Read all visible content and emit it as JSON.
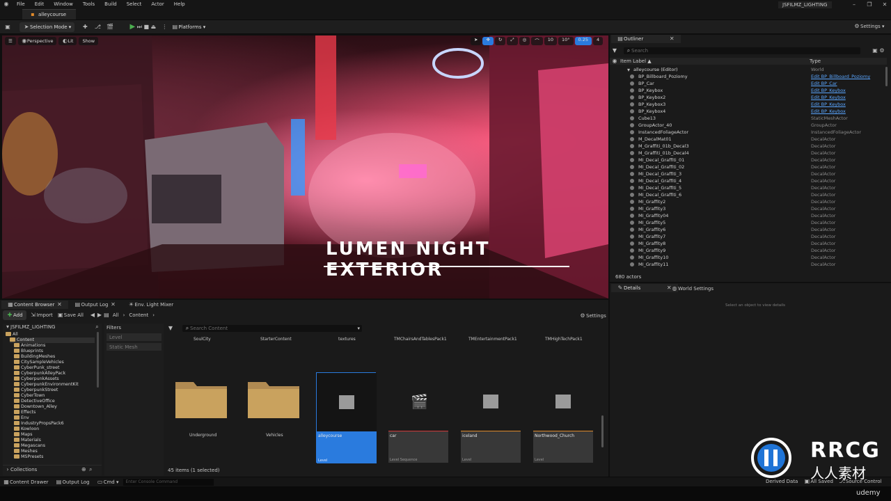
{
  "menu": [
    "File",
    "Edit",
    "Window",
    "Tools",
    "Build",
    "Select",
    "Actor",
    "Help"
  ],
  "project_name": "JSFILMZ_LIGHTING",
  "doc_tab": "alleycourse",
  "toolbar": {
    "mode": "Selection Mode",
    "platforms": "Platforms",
    "settings": "Settings"
  },
  "viewport": {
    "perspective": "Perspective",
    "lit": "Lit",
    "show": "Show",
    "banner": "LUMEN NIGHT EXTERIOR",
    "stats": [
      "10",
      "10°",
      "0.25",
      "4"
    ]
  },
  "outliner": {
    "tab": "Outliner",
    "search_placeholder": "Search",
    "col_label": "Item Label ▲",
    "col_type": "Type",
    "root": {
      "label": "alleycourse (Editor)",
      "type": "World"
    },
    "rows": [
      {
        "label": "BP_Billboard_Poziomy",
        "type": "Edit BP_Billboard_Poziomy",
        "link": true
      },
      {
        "label": "BP_Car",
        "type": "Edit BP_Car",
        "link": true
      },
      {
        "label": "BP_Keybox",
        "type": "Edit BP_Keybox",
        "link": true
      },
      {
        "label": "BP_Keybox2",
        "type": "Edit BP_Keybox",
        "link": true
      },
      {
        "label": "BP_Keybox3",
        "type": "Edit BP_Keybox",
        "link": true
      },
      {
        "label": "BP_Keybox4",
        "type": "Edit BP_Keybox",
        "link": true
      },
      {
        "label": "Cube13",
        "type": "StaticMeshActor",
        "link": false
      },
      {
        "label": "GroupActor_40",
        "type": "GroupActor",
        "link": false
      },
      {
        "label": "InstancedFoliageActor",
        "type": "InstancedFoliageActor",
        "link": false
      },
      {
        "label": "M_DecalMat01",
        "type": "DecalActor",
        "link": false
      },
      {
        "label": "M_Graffiti_01b_Decal3",
        "type": "DecalActor",
        "link": false
      },
      {
        "label": "M_Graffiti_01b_Decal4",
        "type": "DecalActor",
        "link": false
      },
      {
        "label": "MI_Decal_Graffiti_01",
        "type": "DecalActor",
        "link": false
      },
      {
        "label": "MI_Decal_Graffiti_02",
        "type": "DecalActor",
        "link": false
      },
      {
        "label": "MI_Decal_Graffiti_3",
        "type": "DecalActor",
        "link": false
      },
      {
        "label": "MI_Decal_Graffiti_4",
        "type": "DecalActor",
        "link": false
      },
      {
        "label": "MI_Decal_Graffiti_5",
        "type": "DecalActor",
        "link": false
      },
      {
        "label": "MI_Decal_Graffiti_6",
        "type": "DecalActor",
        "link": false
      },
      {
        "label": "MI_Graffity2",
        "type": "DecalActor",
        "link": false
      },
      {
        "label": "MI_Graffity3",
        "type": "DecalActor",
        "link": false
      },
      {
        "label": "MI_Graffity04",
        "type": "DecalActor",
        "link": false
      },
      {
        "label": "MI_Graffity5",
        "type": "DecalActor",
        "link": false
      },
      {
        "label": "MI_Graffity6",
        "type": "DecalActor",
        "link": false
      },
      {
        "label": "MI_Graffity7",
        "type": "DecalActor",
        "link": false
      },
      {
        "label": "MI_Graffity8",
        "type": "DecalActor",
        "link": false
      },
      {
        "label": "MI_Graffity9",
        "type": "DecalActor",
        "link": false
      },
      {
        "label": "MI_Graffity10",
        "type": "DecalActor",
        "link": false
      },
      {
        "label": "MI_Graffity11",
        "type": "DecalActor",
        "link": false
      }
    ],
    "count": "680 actors"
  },
  "details": {
    "tab": "Details",
    "tab2": "World Settings",
    "empty": "Select an object to view details"
  },
  "content_browser": {
    "tabs": [
      "Content Browser",
      "Output Log",
      "Env. Light Mixer"
    ],
    "add": "Add",
    "import": "Import",
    "save_all": "Save All",
    "path": [
      "All",
      "Content"
    ],
    "settings": "Settings",
    "root": "JSFILMZ_LIGHTING",
    "tree": [
      "All",
      "Content",
      "Animations",
      "Blueprints",
      "BuildingMeshes",
      "CitySampleVehicles",
      "CyberPunk_street",
      "CyberpunkAlleyPack",
      "CyberpunkAssets",
      "CyberpunkEnvironmentKit",
      "CyberpunkStreet",
      "CyberTown",
      "DetectiveOffice",
      "Downtown_Alley",
      "Effects",
      "Env",
      "IndustryPropsPack6",
      "Kowloon",
      "Maps",
      "Materials",
      "Megascans",
      "Meshes",
      "MSPresets"
    ],
    "collections": "Collections",
    "filters": "Filters",
    "filter_items": [
      "Level",
      "Static Mesh"
    ],
    "search_placeholder": "Search Content",
    "top_folders": [
      "SoulCity",
      "StarterContent",
      "textures",
      "TMChairsAndTablesPack1",
      "TMEntertainmentPack1",
      "TMHighTechPack1"
    ],
    "folders": [
      "Underground",
      "Vehicles"
    ],
    "assets": [
      {
        "name": "alleycourse",
        "type": "Level",
        "selected": true,
        "accent": "#2a7bde"
      },
      {
        "name": "car",
        "type": "Level Sequence",
        "selected": false,
        "accent": "#d23a3a"
      },
      {
        "name": "iceland",
        "type": "Level",
        "selected": false,
        "accent": "#e08a2a"
      },
      {
        "name": "Northwood_Church",
        "type": "Level",
        "selected": false,
        "accent": "#e08a2a"
      }
    ],
    "count": "45 items (1 selected)"
  },
  "statusbar": {
    "content_drawer": "Content Drawer",
    "output_log": "Output Log",
    "cmd": "Cmd",
    "console_placeholder": "Enter Console Command",
    "derived": "Derived Data",
    "all_saved": "All Saved",
    "source_control": "Source Control"
  },
  "watermark": {
    "brand": "RRCG",
    "sub": "人人素材",
    "udemy": "udemy"
  },
  "colors": {
    "accent": "#2a7bde",
    "folder": "#c9a25e",
    "link": "#5aa6ff",
    "play": "#4caf50"
  }
}
